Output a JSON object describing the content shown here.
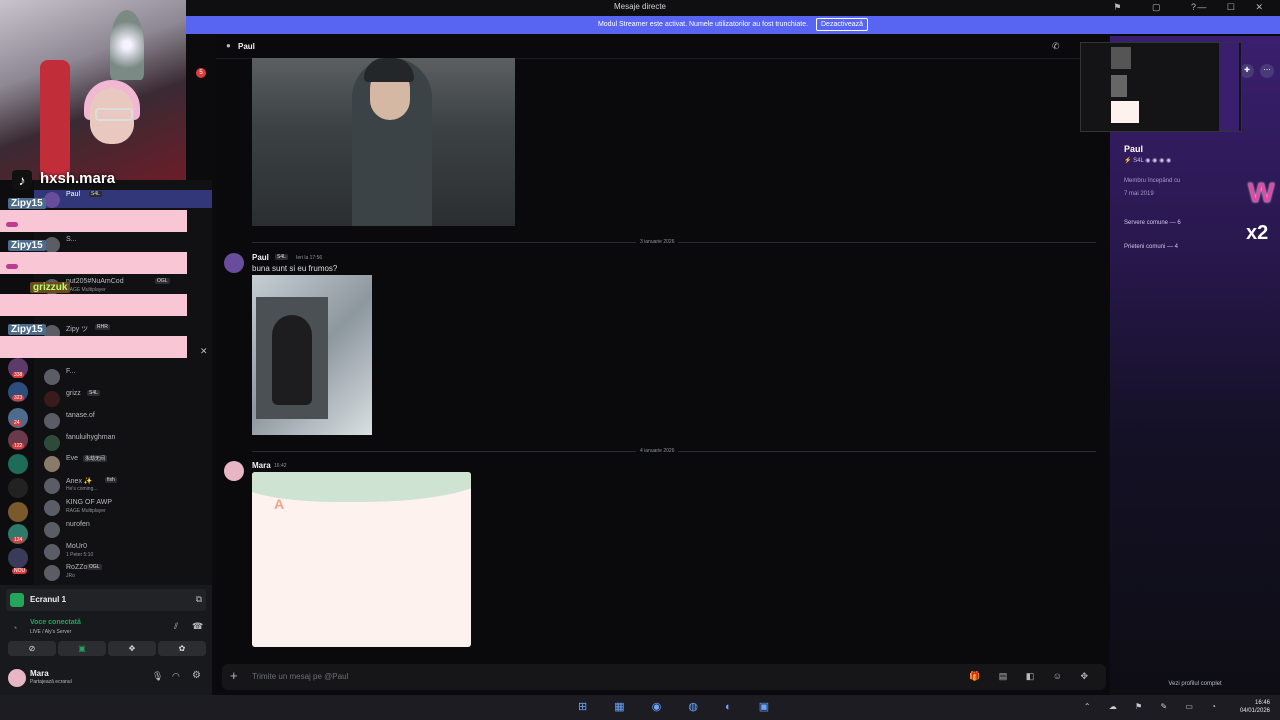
{
  "window": {
    "title": "Mesaje directe"
  },
  "streamer_banner": {
    "text": "Modul Streamer este activat. Numele utilizatorilor au fost trunchiate.",
    "button": "Dezactivează"
  },
  "stream_overlay": {
    "handle": "hxsh.mara",
    "chat_users": [
      "Zipy15",
      "Zipy15",
      "grizzuk",
      "Zipy15"
    ]
  },
  "servers": {
    "badges": [
      "338",
      "323",
      "24",
      "122",
      "124",
      "NOU"
    ],
    "top_badge": "5"
  },
  "dms": [
    {
      "name": "Paul",
      "tag": "S4L",
      "sub": ""
    },
    {
      "name": "S...",
      "tag": "",
      "sub": ""
    },
    {
      "name": "nut205#NuAmCod",
      "tag": "OGL",
      "sub": "RAGE Multiplayer"
    },
    {
      "name": "Zipy ツ",
      "tag": "RHR",
      "sub": ""
    },
    {
      "name": "F...",
      "tag": "",
      "sub": ""
    },
    {
      "name": "grizz",
      "tag": "S4L",
      "sub": ""
    },
    {
      "name": "tanase.of",
      "tag": "",
      "sub": ""
    },
    {
      "name": "fanuluihyghman",
      "tag": "",
      "sub": ""
    },
    {
      "name": "Eve",
      "tag": "永劫无间",
      "sub": ""
    },
    {
      "name": "Anex ✨",
      "tag": "fish",
      "sub": "He's coming..."
    },
    {
      "name": "KING OF AWP",
      "tag": "",
      "sub": "RAGE Multiplayer"
    },
    {
      "name": "nurofen",
      "tag": "",
      "sub": ""
    },
    {
      "name": "MoUr0",
      "tag": "",
      "sub": "1 Peter 5:10"
    },
    {
      "name": "RoZZoR",
      "tag": "OGL",
      "sub": "JRo"
    }
  ],
  "voice": {
    "screen_label": "Ecranul 1",
    "status": "Voce conectată",
    "channel": "LIVE / Aly's Server"
  },
  "user": {
    "name": "Mara",
    "status": "Partajează ecranul"
  },
  "channel": {
    "name": "Paul"
  },
  "messages": [
    {
      "date": "3 ianuarie 2026",
      "author": "Paul",
      "tag": "S4L",
      "time": "Ieri la 17:56",
      "text": "buna sunt si eu frumos?"
    },
    {
      "date": "4 ianuarie 2026",
      "author": "Mara",
      "time": "16:42",
      "text": ""
    }
  ],
  "composer": {
    "placeholder": "Trimite un mesaj pe @Paul"
  },
  "profile": {
    "name": "Paul",
    "tag": "S4L",
    "member_since_label": "Membru începând cu",
    "member_since": "7 mai 2019",
    "mutual_servers": "Servere comune — 6",
    "mutual_friends": "Prieteni comuni — 4",
    "view_full": "Vezi profilul complet"
  },
  "taskbar": {
    "time": "16:46",
    "date": "04/01/2026"
  },
  "colors": {
    "accent": "#5865f2",
    "pink_overlay": "#f9c6d6",
    "online": "#23a55a"
  }
}
